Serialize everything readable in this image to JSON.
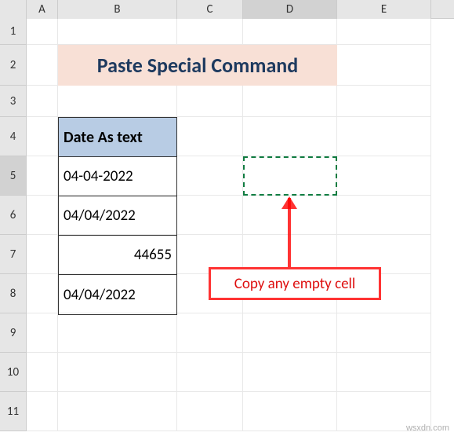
{
  "columns": [
    "A",
    "B",
    "C",
    "D",
    "E"
  ],
  "rows": [
    "1",
    "2",
    "3",
    "4",
    "5",
    "6",
    "7",
    "8",
    "9",
    "10",
    "11"
  ],
  "selected_column": "D",
  "selected_row": "5",
  "title": "Paste Special Command",
  "table": {
    "header": "Date As text",
    "rows": [
      "04-04-2022",
      "04/04/2022",
      "44655",
      "04/04/2022"
    ]
  },
  "annotation": {
    "text": "Copy any empty cell"
  },
  "watermark": "wsxdn.com"
}
